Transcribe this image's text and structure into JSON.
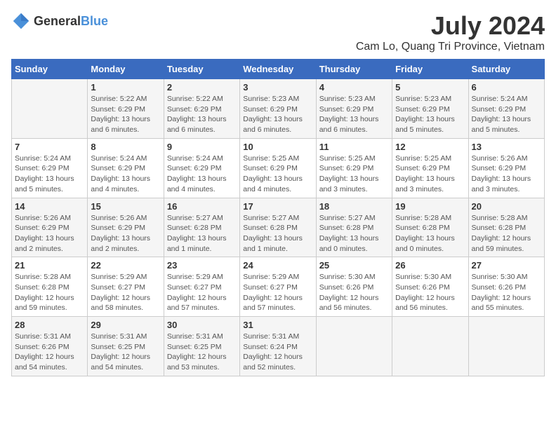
{
  "header": {
    "logo_general": "General",
    "logo_blue": "Blue",
    "month_year": "July 2024",
    "location": "Cam Lo, Quang Tri Province, Vietnam"
  },
  "calendar": {
    "days_of_week": [
      "Sunday",
      "Monday",
      "Tuesday",
      "Wednesday",
      "Thursday",
      "Friday",
      "Saturday"
    ],
    "weeks": [
      [
        {
          "day": "",
          "info": ""
        },
        {
          "day": "1",
          "info": "Sunrise: 5:22 AM\nSunset: 6:29 PM\nDaylight: 13 hours\nand 6 minutes."
        },
        {
          "day": "2",
          "info": "Sunrise: 5:22 AM\nSunset: 6:29 PM\nDaylight: 13 hours\nand 6 minutes."
        },
        {
          "day": "3",
          "info": "Sunrise: 5:23 AM\nSunset: 6:29 PM\nDaylight: 13 hours\nand 6 minutes."
        },
        {
          "day": "4",
          "info": "Sunrise: 5:23 AM\nSunset: 6:29 PM\nDaylight: 13 hours\nand 6 minutes."
        },
        {
          "day": "5",
          "info": "Sunrise: 5:23 AM\nSunset: 6:29 PM\nDaylight: 13 hours\nand 5 minutes."
        },
        {
          "day": "6",
          "info": "Sunrise: 5:24 AM\nSunset: 6:29 PM\nDaylight: 13 hours\nand 5 minutes."
        }
      ],
      [
        {
          "day": "7",
          "info": "Sunrise: 5:24 AM\nSunset: 6:29 PM\nDaylight: 13 hours\nand 5 minutes."
        },
        {
          "day": "8",
          "info": "Sunrise: 5:24 AM\nSunset: 6:29 PM\nDaylight: 13 hours\nand 4 minutes."
        },
        {
          "day": "9",
          "info": "Sunrise: 5:24 AM\nSunset: 6:29 PM\nDaylight: 13 hours\nand 4 minutes."
        },
        {
          "day": "10",
          "info": "Sunrise: 5:25 AM\nSunset: 6:29 PM\nDaylight: 13 hours\nand 4 minutes."
        },
        {
          "day": "11",
          "info": "Sunrise: 5:25 AM\nSunset: 6:29 PM\nDaylight: 13 hours\nand 3 minutes."
        },
        {
          "day": "12",
          "info": "Sunrise: 5:25 AM\nSunset: 6:29 PM\nDaylight: 13 hours\nand 3 minutes."
        },
        {
          "day": "13",
          "info": "Sunrise: 5:26 AM\nSunset: 6:29 PM\nDaylight: 13 hours\nand 3 minutes."
        }
      ],
      [
        {
          "day": "14",
          "info": "Sunrise: 5:26 AM\nSunset: 6:29 PM\nDaylight: 13 hours\nand 2 minutes."
        },
        {
          "day": "15",
          "info": "Sunrise: 5:26 AM\nSunset: 6:29 PM\nDaylight: 13 hours\nand 2 minutes."
        },
        {
          "day": "16",
          "info": "Sunrise: 5:27 AM\nSunset: 6:28 PM\nDaylight: 13 hours\nand 1 minute."
        },
        {
          "day": "17",
          "info": "Sunrise: 5:27 AM\nSunset: 6:28 PM\nDaylight: 13 hours\nand 1 minute."
        },
        {
          "day": "18",
          "info": "Sunrise: 5:27 AM\nSunset: 6:28 PM\nDaylight: 13 hours\nand 0 minutes."
        },
        {
          "day": "19",
          "info": "Sunrise: 5:28 AM\nSunset: 6:28 PM\nDaylight: 13 hours\nand 0 minutes."
        },
        {
          "day": "20",
          "info": "Sunrise: 5:28 AM\nSunset: 6:28 PM\nDaylight: 12 hours\nand 59 minutes."
        }
      ],
      [
        {
          "day": "21",
          "info": "Sunrise: 5:28 AM\nSunset: 6:28 PM\nDaylight: 12 hours\nand 59 minutes."
        },
        {
          "day": "22",
          "info": "Sunrise: 5:29 AM\nSunset: 6:27 PM\nDaylight: 12 hours\nand 58 minutes."
        },
        {
          "day": "23",
          "info": "Sunrise: 5:29 AM\nSunset: 6:27 PM\nDaylight: 12 hours\nand 57 minutes."
        },
        {
          "day": "24",
          "info": "Sunrise: 5:29 AM\nSunset: 6:27 PM\nDaylight: 12 hours\nand 57 minutes."
        },
        {
          "day": "25",
          "info": "Sunrise: 5:30 AM\nSunset: 6:26 PM\nDaylight: 12 hours\nand 56 minutes."
        },
        {
          "day": "26",
          "info": "Sunrise: 5:30 AM\nSunset: 6:26 PM\nDaylight: 12 hours\nand 56 minutes."
        },
        {
          "day": "27",
          "info": "Sunrise: 5:30 AM\nSunset: 6:26 PM\nDaylight: 12 hours\nand 55 minutes."
        }
      ],
      [
        {
          "day": "28",
          "info": "Sunrise: 5:31 AM\nSunset: 6:26 PM\nDaylight: 12 hours\nand 54 minutes."
        },
        {
          "day": "29",
          "info": "Sunrise: 5:31 AM\nSunset: 6:25 PM\nDaylight: 12 hours\nand 54 minutes."
        },
        {
          "day": "30",
          "info": "Sunrise: 5:31 AM\nSunset: 6:25 PM\nDaylight: 12 hours\nand 53 minutes."
        },
        {
          "day": "31",
          "info": "Sunrise: 5:31 AM\nSunset: 6:24 PM\nDaylight: 12 hours\nand 52 minutes."
        },
        {
          "day": "",
          "info": ""
        },
        {
          "day": "",
          "info": ""
        },
        {
          "day": "",
          "info": ""
        }
      ]
    ]
  }
}
